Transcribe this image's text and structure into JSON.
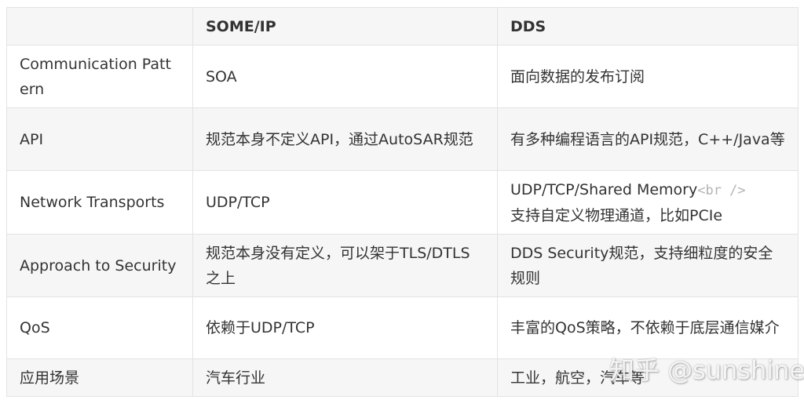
{
  "table": {
    "headers": [
      "",
      "SOME/IP",
      "DDS"
    ],
    "rows": [
      {
        "feature": "Communication Pattern",
        "someip": "SOA",
        "dds": "面向数据的发布订阅"
      },
      {
        "feature": "API",
        "someip": "规范本身不定义API，通过AutoSAR规范",
        "dds": "有多种编程语言的API规范，C++/Java等"
      },
      {
        "feature": "Network Transports",
        "someip": "UDP/TCP",
        "dds_part1": "UDP/TCP/Shared Memory",
        "dds_tag": "<br />",
        "dds_part2": "支持自定义物理通道，比如PCIe"
      },
      {
        "feature": "Approach to Security",
        "someip": "规范本身没有定义，可以架于TLS/DTLS之上",
        "dds": "DDS Security规范，支持细粒度的安全规则"
      },
      {
        "feature": "QoS",
        "someip": "依赖于UDP/TCP",
        "dds": "丰富的QoS策略，不依赖于底层通信媒介"
      },
      {
        "feature": "应用场景",
        "someip": "汽车行业",
        "dds": "工业，航空，汽车等"
      }
    ]
  },
  "watermark": "知乎 @sunshine",
  "colors": {
    "border": "#e3e3e3",
    "stripe": "#f6f6f6",
    "text": "#333333",
    "tag": "#b4b4b4"
  }
}
